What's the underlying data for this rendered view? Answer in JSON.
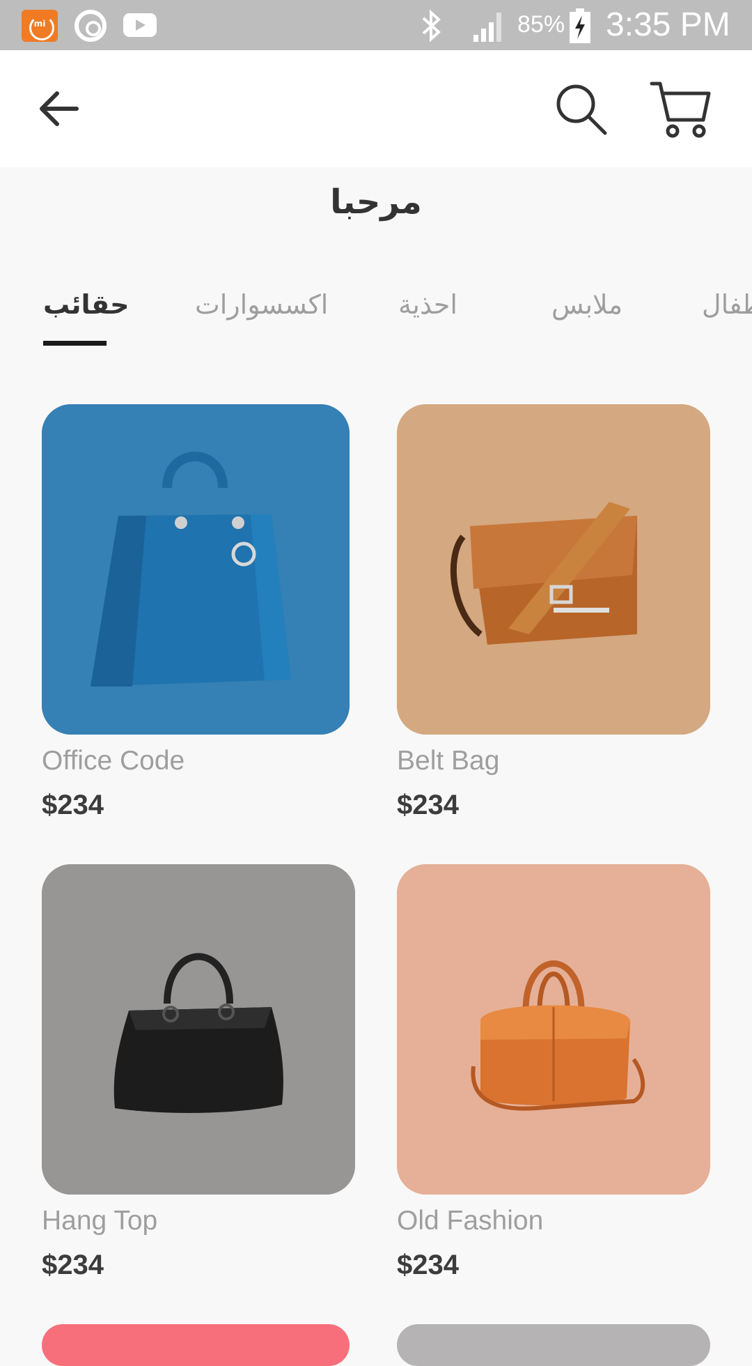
{
  "status_bar": {
    "battery_percent": "85%",
    "time": "3:35 PM",
    "icons": [
      "mi-icon",
      "sync-icon",
      "youtube-icon",
      "bluetooth-icon",
      "signal-icon",
      "battery-charging-icon"
    ]
  },
  "app_bar": {
    "icons": [
      "back-arrow-icon",
      "search-icon",
      "cart-icon"
    ]
  },
  "greeting": "مرحبا",
  "tabs": [
    {
      "label": "حقائب",
      "active": true
    },
    {
      "label": "اكسسوارات",
      "active": false
    },
    {
      "label": "احذية",
      "active": false
    },
    {
      "label": "ملابس",
      "active": false
    },
    {
      "label": "اطفال",
      "active": false
    }
  ],
  "products": [
    {
      "name": "Office Code",
      "price": "$234",
      "bg": "#3580b4"
    },
    {
      "name": "Belt Bag",
      "price": "$234",
      "bg": "#d4a880"
    },
    {
      "name": "Hang Top",
      "price": "$234",
      "bg": "#989595"
    },
    {
      "name": "Old Fashion",
      "price": "$234",
      "bg": "#e5b097"
    }
  ],
  "partial_cards_bg": [
    "#f76f7a",
    "#b5b3b3"
  ]
}
